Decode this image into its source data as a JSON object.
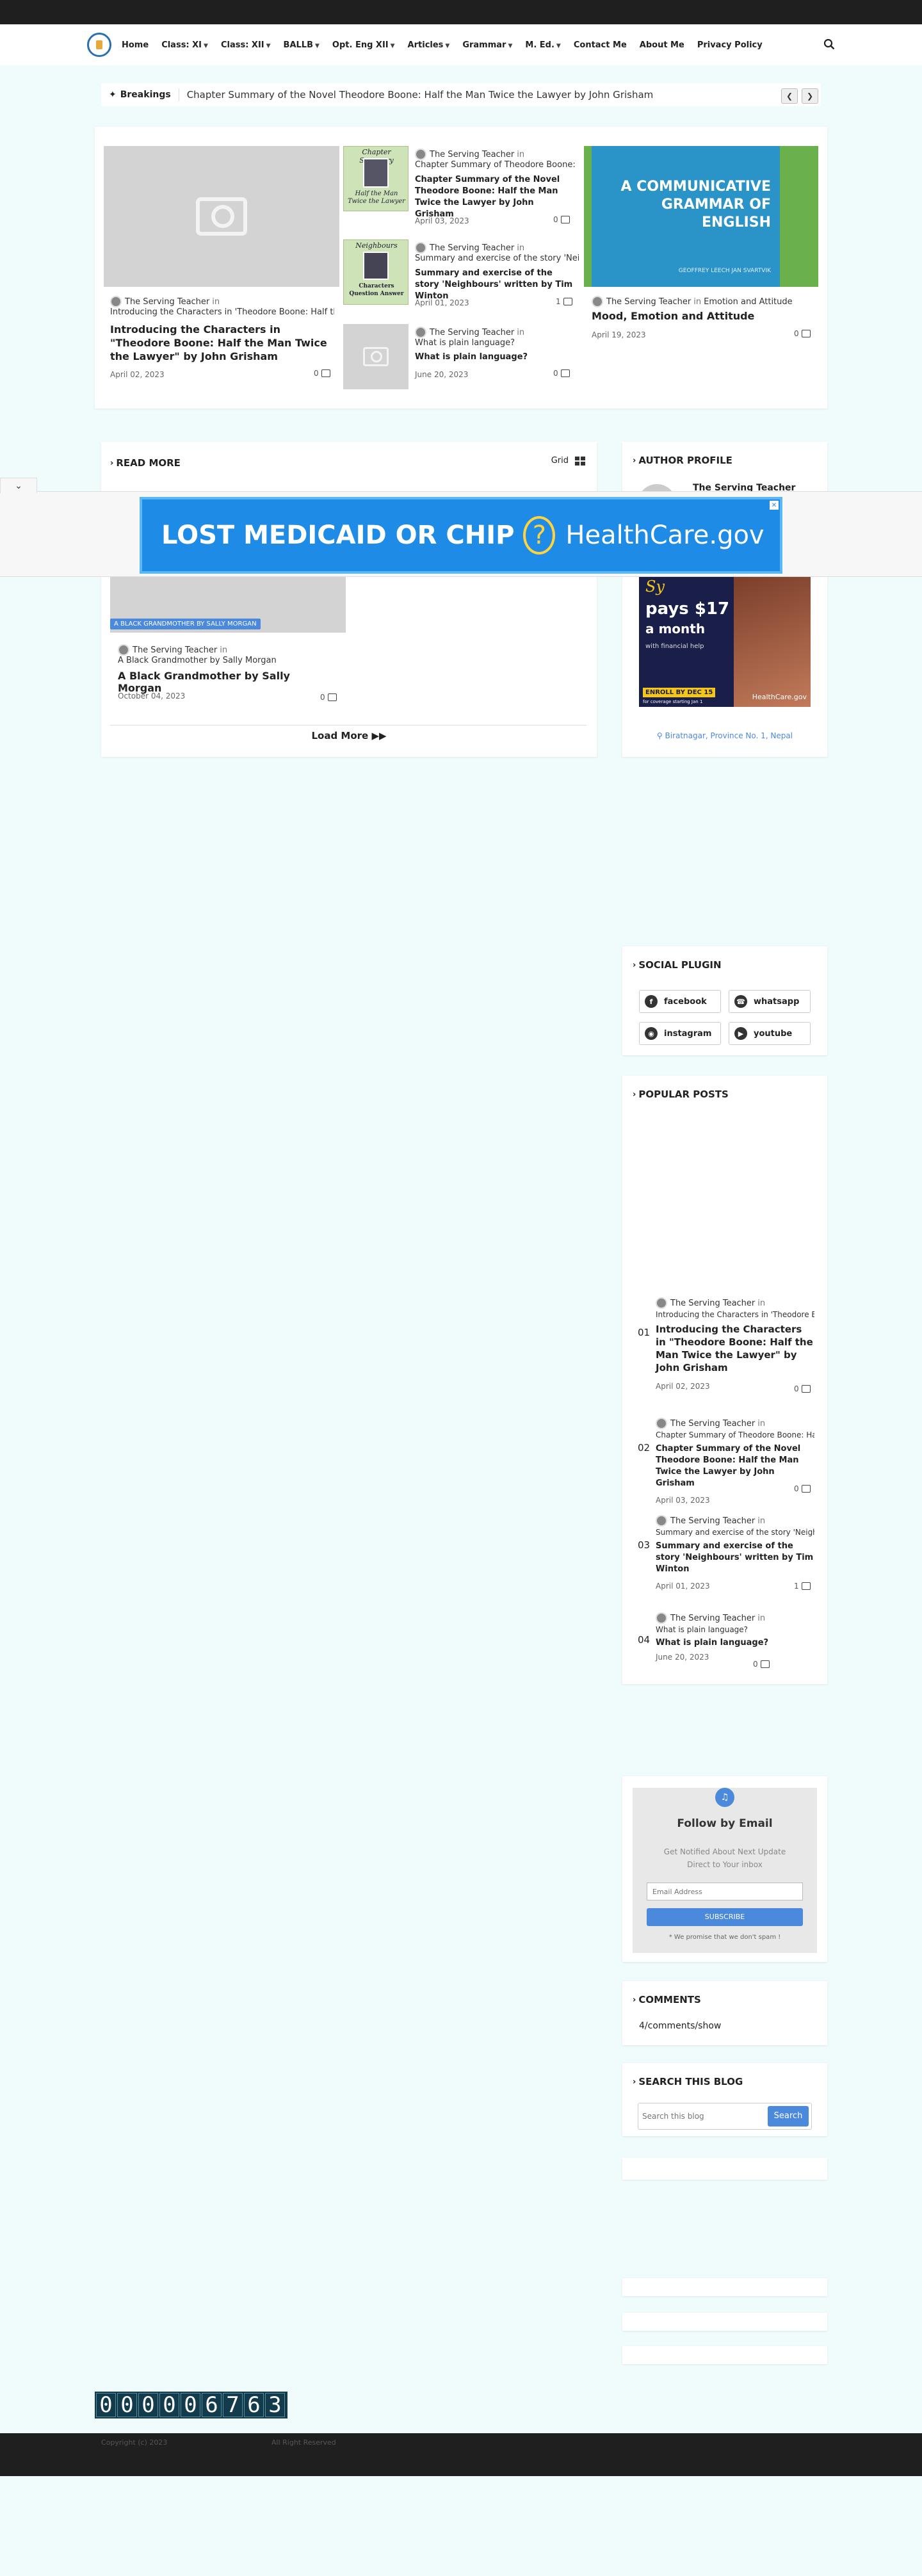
{
  "nav": {
    "items": [
      {
        "label": "Home",
        "dropdown": false
      },
      {
        "label": "Class: XI",
        "dropdown": true
      },
      {
        "label": "Class: XII",
        "dropdown": true
      },
      {
        "label": "BALLB",
        "dropdown": true
      },
      {
        "label": "Opt. Eng XII",
        "dropdown": true
      },
      {
        "label": "Articles",
        "dropdown": true
      },
      {
        "label": "Grammar",
        "dropdown": true
      },
      {
        "label": "M. Ed.",
        "dropdown": true
      },
      {
        "label": "Contact Me",
        "dropdown": false
      },
      {
        "label": "About Me",
        "dropdown": false
      },
      {
        "label": "Privacy Policy",
        "dropdown": false
      }
    ]
  },
  "breaking": {
    "label": "Breakings",
    "text": "Chapter Summary of the Novel Theodore Boone: Half the Man Twice the Lawyer by John Grisham"
  },
  "featured": {
    "main": {
      "author": "The Serving Teacher",
      "in_word": "in",
      "subtitle": "Introducing the Characters in 'Theodore Boone: Half the Man Twice the Lawyer' by John Grisham",
      "title": "Introducing the Characters in \"Theodore Boone: Half the Man Twice the Lawyer\" by John Grisham",
      "date": "April 02, 2023",
      "comments": "0"
    },
    "middle": [
      {
        "thumb_text": "Chapter Summary\nHalf the Man Twice the Lawyer",
        "author": "The Serving Teacher",
        "in_word": "in",
        "subtitle": "Chapter Summary of Theodore Boone: Half the Man Twice the Lawyer",
        "title": "Chapter Summary of the Novel Theodore Boone: Half the Man Twice the Lawyer by John Grisham",
        "date": "April 03, 2023",
        "comments": "0"
      },
      {
        "thumb_text": "Neighbours\nCharacters\nQuestion Answer",
        "author": "The Serving Teacher",
        "in_word": "in",
        "subtitle": "Summary and exercise of the story 'Neighbours' written by Tim Winton",
        "title": "Summary and exercise of the story 'Neighbours' written by Tim Winton",
        "date": "April 01, 2023",
        "comments": "1"
      },
      {
        "author": "The Serving Teacher",
        "in_word": "in",
        "subtitle": "What is plain language?",
        "title": "What is plain language?",
        "date": "June 20, 2023",
        "comments": "0"
      }
    ],
    "right": {
      "thumb_text": "A COMMUNICATIVE GRAMMAR OF ENGLISH",
      "thumb_authors": "GEOFFREY LEECH  JAN SVARTVIK",
      "author": "The Serving Teacher",
      "in_word": "in",
      "subtitle": "Emotion and Attitude",
      "title": "Mood, Emotion and Attitude",
      "date": "April 19, 2023",
      "comments": "0"
    }
  },
  "readmore": {
    "title": "READ MORE",
    "view_label": "Grid",
    "post": {
      "label_badge": "A BLACK GRANDMOTHER BY SALLY MORGAN",
      "author": "The Serving Teacher",
      "in_word": "in",
      "subtitle": "A Black Grandmother by Sally Morgan",
      "title": "A Black Grandmother by Sally Morgan",
      "date": "October 04, 2023",
      "comments": "0"
    },
    "load_more": "Load More"
  },
  "ad": {
    "text": "LOST MEDICAID OR CHIP",
    "brand": "HealthCare.gov",
    "side": {
      "headline_1": "Sy",
      "headline_2": "pays $17",
      "headline_3": "a month",
      "small": "with financial help",
      "enroll": "ENROLL BY DEC 15",
      "note": "for coverage starting Jan 1",
      "brand": "HealthCare.gov"
    }
  },
  "author_profile": {
    "title": "AUTHOR PROFILE",
    "name": "The Serving Teacher",
    "location": "Biratnagar, Province No. 1, Nepal"
  },
  "social": {
    "title": "SOCIAL PLUGIN",
    "items": [
      {
        "label": "facebook",
        "icon": "facebook-icon"
      },
      {
        "label": "whatsapp",
        "icon": "whatsapp-icon"
      },
      {
        "label": "instagram",
        "icon": "instagram-icon"
      },
      {
        "label": "youtube",
        "icon": "youtube-icon"
      }
    ]
  },
  "popular": {
    "title": "POPULAR POSTS",
    "items": [
      {
        "num": "01",
        "author": "The Serving Teacher",
        "in_word": "in",
        "subtitle": "Introducing the Characters in 'Theodore Boone: Half the Man Twice the Lawyer'",
        "title": "Introducing the Characters in \"Theodore Boone: Half the Man Twice the Lawyer\" by John Grisham",
        "date": "April 02, 2023",
        "comments": "0"
      },
      {
        "num": "02",
        "author": "The Serving Teacher",
        "in_word": "in",
        "subtitle": "Chapter Summary of Theodore Boone: Half the Man Twice the Lawyer",
        "title": "Chapter Summary of the Novel Theodore Boone: Half the Man Twice the Lawyer by John Grisham",
        "date": "April 03, 2023",
        "comments": "0"
      },
      {
        "num": "03",
        "author": "The Serving Teacher",
        "in_word": "in",
        "subtitle": "Summary and exercise of the story 'Neighbours' written by Tim Winton",
        "title": "Summary and exercise of the story 'Neighbours' written by Tim Winton",
        "date": "April 01, 2023",
        "comments": "1"
      },
      {
        "num": "04",
        "author": "The Serving Teacher",
        "in_word": "in",
        "subtitle": "What is plain language?",
        "title": "What is plain language?",
        "date": "June 20, 2023",
        "comments": "0"
      }
    ]
  },
  "follow": {
    "title": "Follow by Email",
    "desc": "Get Notified About Next Update Direct to Your inbox",
    "placeholder": "Email Address",
    "button": "SUBSCRIBE",
    "note": "* We promise that we don't spam !"
  },
  "comments_widget": {
    "title": "COMMENTS",
    "text": "4/comments/show"
  },
  "search_widget": {
    "title": "SEARCH THIS BLOG",
    "placeholder": "Search this blog",
    "button": "Search"
  },
  "counter": {
    "digits": [
      "0",
      "0",
      "0",
      "0",
      "0",
      "6",
      "7",
      "6",
      "3"
    ]
  },
  "footer": {
    "copyright": "Copyright (c) 2023",
    "rights": "All Right Reserved"
  },
  "colors": {
    "accent": "#4b89dc",
    "dark": "#1f1f1f",
    "page_bg": "#f0fbfb"
  }
}
